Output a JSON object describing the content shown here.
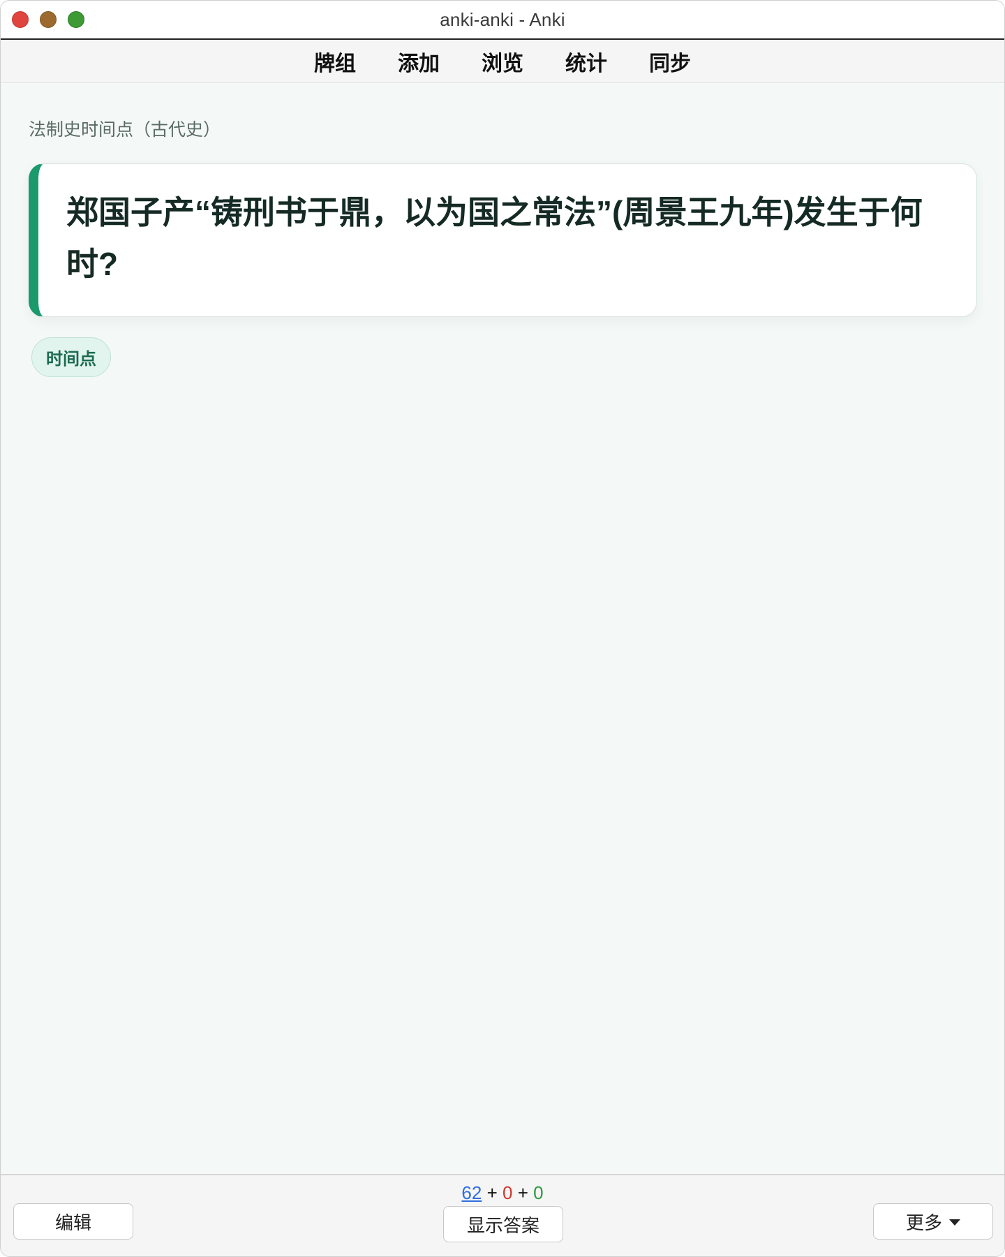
{
  "window": {
    "title": "anki-anki - Anki"
  },
  "toolbar": {
    "items": [
      "牌组",
      "添加",
      "浏览",
      "统计",
      "同步"
    ]
  },
  "main": {
    "deck_path": "法制史时间点（古代史）",
    "card": {
      "question": "郑国子产“铸刑书于鼎，以为国之常法”(周景王九年)发生于何时?"
    },
    "tag": "时间点"
  },
  "bottom": {
    "counts": {
      "new": "62",
      "sep1": "+",
      "learn": "0",
      "sep2": "+",
      "review": "0"
    },
    "edit_label": "编辑",
    "show_answer_label": "显示答案",
    "more_label": "更多"
  },
  "colors": {
    "accent": "#1a9a6c",
    "new_count": "#2f6ee0",
    "learn_count": "#d0392f",
    "review_count": "#2a9a3d"
  },
  "icons": {
    "close": "close-window-icon",
    "minimize": "minimize-window-icon",
    "maximize": "maximize-window-icon",
    "more_dropdown": "caret-down-icon"
  }
}
